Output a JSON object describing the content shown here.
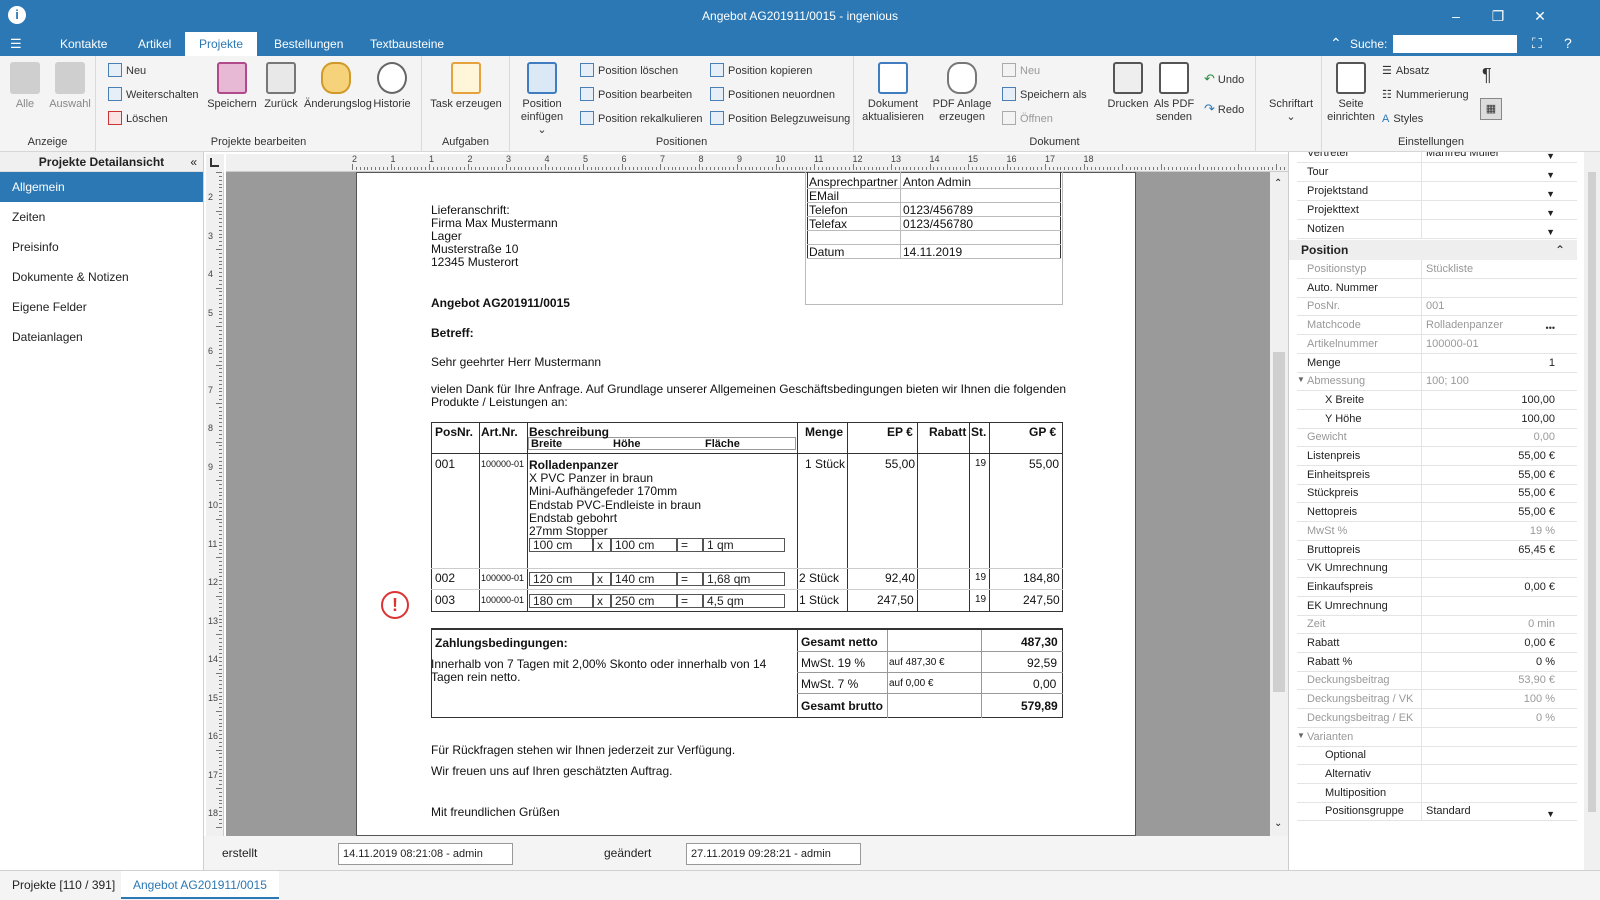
{
  "window": {
    "title": "Angebot AG201911/0015 - ingenious"
  },
  "menu": {
    "tabs": [
      "Kontakte",
      "Artikel",
      "Projekte",
      "Bestellungen",
      "Textbausteine"
    ],
    "active": "Projekte",
    "search_label": "Suche:"
  },
  "ribbon": {
    "groups": [
      "Anzeige",
      "Projekte bearbeiten",
      "Aufgaben",
      "Positionen",
      "Dokument",
      "Einstellungen"
    ],
    "anzeige": [
      "Alle",
      "Auswahl"
    ],
    "projekte_small": [
      "Neu",
      "Weiterschalten",
      "Löschen"
    ],
    "projekte_big": [
      "Speichern",
      "Zurück",
      "Änderungslog",
      "Historie"
    ],
    "aufgaben": "Task erzeugen",
    "position_einfuegen": [
      "Position",
      "einfügen ⌄"
    ],
    "positionen_col1": [
      "Position löschen",
      "Position bearbeiten",
      "Position rekalkulieren"
    ],
    "positionen_col2": [
      "Position kopieren",
      "Positionen neuordnen",
      "Position Belegzuweisung"
    ],
    "dok_aktualisieren": [
      "Dokument",
      "aktualisieren"
    ],
    "pdf_anlage": [
      "PDF Anlage",
      "erzeugen"
    ],
    "dokument_small": [
      "Neu",
      "Speichern als",
      "Öffnen"
    ],
    "drucken": "Drucken",
    "als_pdf": [
      "Als PDF",
      "senden"
    ],
    "undo": "Undo",
    "redo": "Redo",
    "schriftart": "Schriftart",
    "seite_einrichten": [
      "Seite",
      "einrichten"
    ],
    "einstellungen_small": [
      "Absatz",
      "Nummerierung",
      "Styles"
    ]
  },
  "sidebar": {
    "title": "Projekte Detailansicht",
    "items": [
      "Allgemein",
      "Zeiten",
      "Preisinfo",
      "Dokumente & Notizen",
      "Eigene Felder",
      "Dateianlagen"
    ],
    "active": "Allgemein"
  },
  "ruler": {
    "h": [
      "2",
      "1",
      "1",
      "2",
      "3",
      "4",
      "5",
      "6",
      "7",
      "8",
      "9",
      "10",
      "11",
      "12",
      "13",
      "14",
      "15",
      "16",
      "17",
      "18"
    ],
    "v": [
      "2",
      "3",
      "4",
      "5",
      "6",
      "7",
      "8",
      "9",
      "10",
      "11",
      "12",
      "13",
      "14",
      "15",
      "16",
      "17",
      "18"
    ]
  },
  "doc": {
    "contact": [
      [
        "Ansprechpartner",
        "Anton Admin"
      ],
      [
        "EMail",
        ""
      ],
      [
        "Telefon",
        "0123/456789"
      ],
      [
        "Telefax",
        "0123/456780"
      ],
      [
        "",
        ""
      ],
      [
        "Datum",
        "14.11.2019"
      ]
    ],
    "address": [
      "Lieferanschrift:",
      "Firma Max Mustermann",
      "Lager",
      "Musterstraße 10",
      "12345 Musterort"
    ],
    "offer_title": "Angebot AG201911/0015",
    "betreff": "Betreff:",
    "greeting": "Sehr geehrter Herr Mustermann",
    "intro1": "vielen Dank für Ihre Anfrage. Auf Grundlage unserer Allgemeinen Geschäftsbedingungen bieten wir Ihnen die folgenden",
    "intro2": "Produkte / Leistungen an:",
    "table_head": {
      "posnr": "PosNr.",
      "artnr": "Art.Nr.",
      "beschreibung": "Beschreibung",
      "breite": "Breite",
      "hoehe": "Höhe",
      "flaeche": "Fläche",
      "menge": "Menge",
      "ep": "EP €",
      "rabatt": "Rabatt",
      "st": "St.",
      "gp": "GP €"
    },
    "rows": [
      {
        "pos": "001",
        "art": "100000-01",
        "name": "Rolladenpanzer",
        "desc": [
          "X PVC Panzer in braun",
          "Mini-Aufhängefeder 170mm",
          "Endstab PVC-Endleiste in braun",
          "Endstab gebohrt",
          "27mm Stopper"
        ],
        "breite": "100 cm",
        "x": "x",
        "hoehe": "100 cm",
        "eq": "=",
        "flaeche": "1 qm",
        "menge": "1 Stück",
        "ep": "55,00",
        "st": "19",
        "gp": "55,00"
      },
      {
        "pos": "002",
        "art": "100000-01",
        "breite": "120 cm",
        "x": "x",
        "hoehe": "140 cm",
        "eq": "=",
        "flaeche": "1,68 qm",
        "menge": "2 Stück",
        "ep": "92,40",
        "st": "19",
        "gp": "184,80"
      },
      {
        "pos": "003",
        "art": "100000-01",
        "breite": "180 cm",
        "x": "x",
        "hoehe": "250 cm",
        "eq": "=",
        "flaeche": "4,5 qm",
        "menge": "1 Stück",
        "ep": "247,50",
        "st": "19",
        "gp": "247,50"
      }
    ],
    "payment_title": "Zahlungsbedingungen:",
    "payment_text1": "Innerhalb von 7 Tagen mit 2,00% Skonto oder innerhalb von 14",
    "payment_text2": "Tagen rein netto.",
    "totals": [
      [
        "Gesamt netto",
        "",
        "487,30"
      ],
      [
        "MwSt. 19 %",
        "auf 487,30 €",
        "92,59"
      ],
      [
        "MwSt. 7 %",
        "auf 0,00 €",
        "0,00"
      ],
      [
        "Gesamt brutto",
        "",
        "579,89"
      ]
    ],
    "closing1": "Für Rückfragen stehen wir Ihnen jederzeit zur Verfügung.",
    "closing2": "Wir freuen uns auf Ihren geschätzten Auftrag.",
    "closing3": "Mit freundlichen Grüßen",
    "warning_icon": "exclamation-circle-icon"
  },
  "status": {
    "erstellt_label": "erstellt",
    "erstellt": "14.11.2019 08:21:08 - admin",
    "geaendert_label": "geändert",
    "geaendert": "27.11.2019 09:28:21 - admin"
  },
  "bottom_tabs": [
    "Projekte [110 / 391]",
    "Angebot AG201911/0015"
  ],
  "props": {
    "top": [
      [
        "Vertreter",
        "Manfred Müller"
      ],
      [
        "Tour",
        ""
      ],
      [
        "Projektstand",
        ""
      ],
      [
        "Projekttext",
        ""
      ],
      [
        "Notizen",
        ""
      ]
    ],
    "section": "Position",
    "rows": [
      [
        "Positionstyp",
        "Stückliste"
      ],
      [
        "Auto. Nummer",
        "✓"
      ],
      [
        "PosNr.",
        "001"
      ],
      [
        "Matchcode",
        "Rolladenpanzer"
      ],
      [
        "Artikelnummer",
        "100000-01"
      ],
      [
        "Menge",
        "1"
      ],
      [
        "Abmessung",
        "100; 100"
      ],
      [
        "X Breite",
        "100,00"
      ],
      [
        "Y Höhe",
        "100,00"
      ],
      [
        "Gewicht",
        "0,00"
      ],
      [
        "Listenpreis",
        "55,00 €"
      ],
      [
        "Einheitspreis",
        "55,00 €"
      ],
      [
        "Stückpreis",
        "55,00 €"
      ],
      [
        "Nettopreis",
        "55,00 €"
      ],
      [
        "MwSt %",
        "19 %"
      ],
      [
        "Bruttopreis",
        "65,45 €"
      ],
      [
        "VK Umrechnung",
        ""
      ],
      [
        "Einkaufspreis",
        "0,00 €"
      ],
      [
        "EK Umrechnung",
        ""
      ],
      [
        "Zeit",
        "0 min"
      ],
      [
        "Rabatt",
        "0,00 €"
      ],
      [
        "Rabatt %",
        "0 %"
      ],
      [
        "Deckungsbeitrag",
        "53,90 €"
      ],
      [
        "Deckungsbeitrag / VK",
        "100 %"
      ],
      [
        "Deckungsbeitrag / EK",
        "0 %"
      ],
      [
        "Varianten",
        ""
      ],
      [
        "Optional",
        ""
      ],
      [
        "Alternativ",
        ""
      ],
      [
        "Multiposition",
        ""
      ],
      [
        "Positionsgruppe",
        "Standard"
      ]
    ]
  }
}
